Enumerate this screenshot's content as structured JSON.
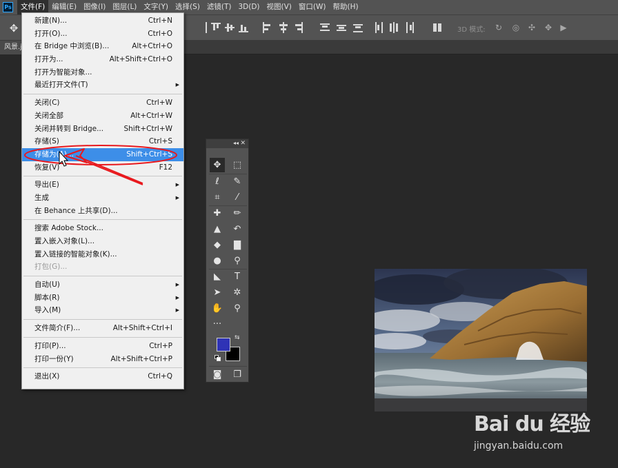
{
  "app": {
    "logo": "Ps"
  },
  "menubar": {
    "items": [
      "文件(F)",
      "编辑(E)",
      "图像(I)",
      "图层(L)",
      "文字(Y)",
      "选择(S)",
      "滤镜(T)",
      "3D(D)",
      "视图(V)",
      "窗口(W)",
      "帮助(H)"
    ]
  },
  "options_bar": {
    "mode_3d_label": "3D 模式:"
  },
  "document_tab": {
    "label": "风景.jp"
  },
  "file_menu": {
    "items": [
      {
        "label": "新建(N)...",
        "shortcut": "Ctrl+N"
      },
      {
        "label": "打开(O)...",
        "shortcut": "Ctrl+O"
      },
      {
        "label": "在 Bridge 中浏览(B)...",
        "shortcut": "Alt+Ctrl+O"
      },
      {
        "label": "打开为...",
        "shortcut": "Alt+Shift+Ctrl+O"
      },
      {
        "label": "打开为智能对象...",
        "shortcut": ""
      },
      {
        "label": "最近打开文件(T)",
        "shortcut": ""
      },
      {
        "label": "关闭(C)",
        "shortcut": "Ctrl+W"
      },
      {
        "label": "关闭全部",
        "shortcut": "Alt+Ctrl+W"
      },
      {
        "label": "关闭并转到 Bridge...",
        "shortcut": "Shift+Ctrl+W"
      },
      {
        "label": "存储(S)",
        "shortcut": "Ctrl+S"
      },
      {
        "label": "存储为(A)...",
        "shortcut": "Shift+Ctrl+S"
      },
      {
        "label": "恢复(V)",
        "shortcut": "F12"
      },
      {
        "label": "导出(E)",
        "shortcut": ""
      },
      {
        "label": "生成",
        "shortcut": ""
      },
      {
        "label": "在 Behance 上共享(D)...",
        "shortcut": ""
      },
      {
        "label": "搜索 Adobe Stock...",
        "shortcut": ""
      },
      {
        "label": "置入嵌入对象(L)...",
        "shortcut": ""
      },
      {
        "label": "置入链接的智能对象(K)...",
        "shortcut": ""
      },
      {
        "label": "打包(G)...",
        "shortcut": ""
      },
      {
        "label": "自动(U)",
        "shortcut": ""
      },
      {
        "label": "脚本(R)",
        "shortcut": ""
      },
      {
        "label": "导入(M)",
        "shortcut": ""
      },
      {
        "label": "文件简介(F)...",
        "shortcut": "Alt+Shift+Ctrl+I"
      },
      {
        "label": "打印(P)...",
        "shortcut": "Ctrl+P"
      },
      {
        "label": "打印一份(Y)",
        "shortcut": "Alt+Shift+Ctrl+P"
      },
      {
        "label": "退出(X)",
        "shortcut": "Ctrl+Q"
      }
    ],
    "highlighted": "存储为(A)..."
  },
  "toolbox": {
    "tools": [
      "move-tool",
      "marquee-tool",
      "lasso-tool",
      "quick-select-tool",
      "crop-tool",
      "eyedropper-tool",
      "healing-brush-tool",
      "brush-tool",
      "clone-stamp-tool",
      "history-brush-tool",
      "eraser-tool",
      "gradient-tool",
      "blur-tool",
      "dodge-tool",
      "pen-tool",
      "type-tool",
      "path-select-tool",
      "custom-shape-tool",
      "hand-tool",
      "zoom-tool",
      "more-tools",
      "quick-mask-tool",
      "screen-mode-tool"
    ],
    "foreground_color": "#2f33b6",
    "background_color": "#000000"
  },
  "watermark": {
    "brand": "Bai du 经验",
    "url": "jingyan.baidu.com"
  },
  "colors": {
    "accent": "#3d8ee8",
    "annotation": "#e8191e"
  }
}
